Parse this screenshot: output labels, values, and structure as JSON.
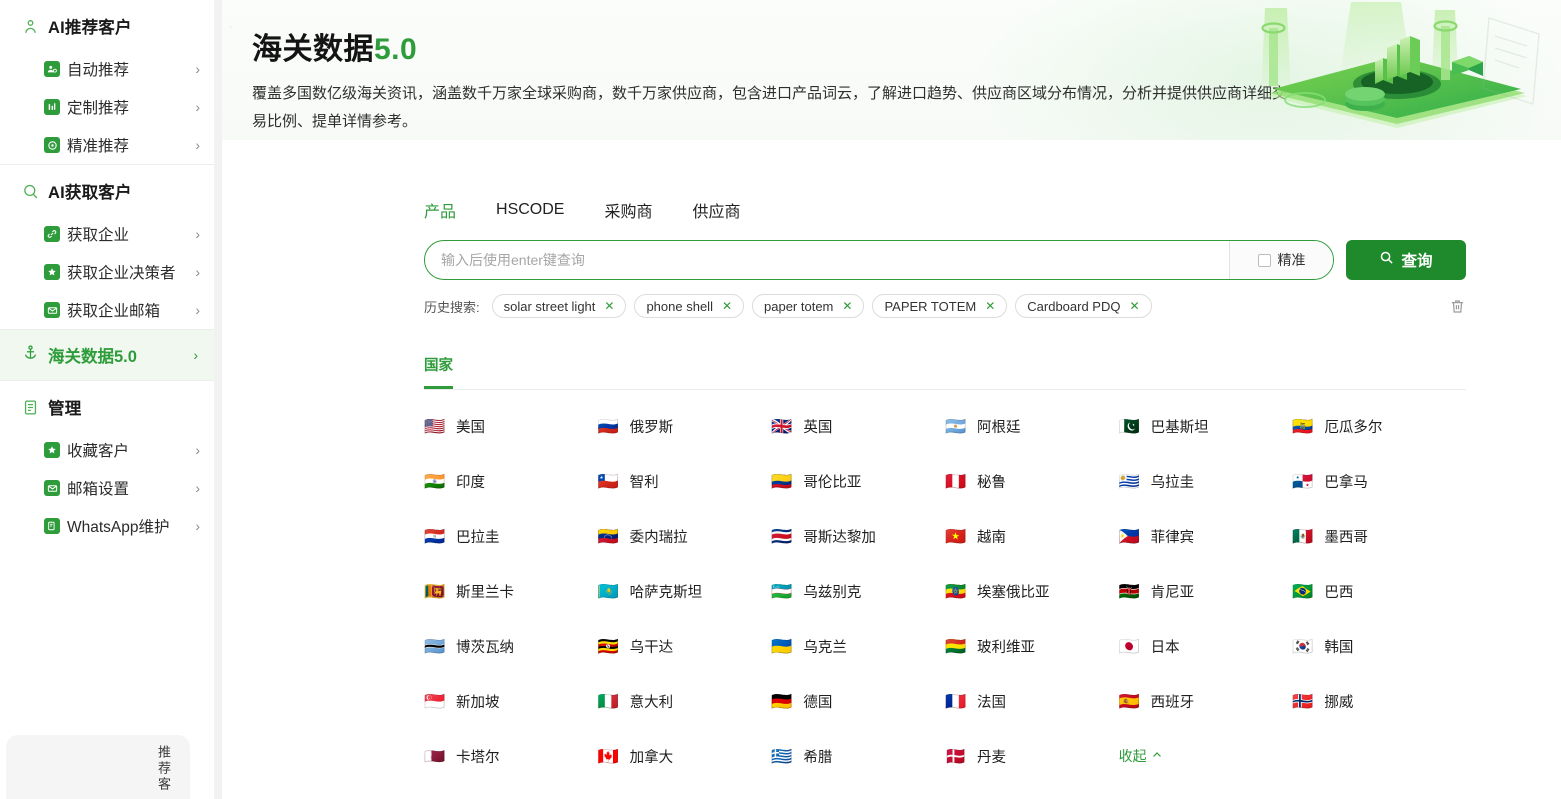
{
  "sidebar": {
    "groups": [
      {
        "title": "AI推荐客户",
        "icon": "person-icon",
        "items": [
          {
            "label": "自动推荐",
            "icon": "user-add-icon",
            "glyph": "☰"
          },
          {
            "label": "定制推荐",
            "icon": "sliders-icon",
            "glyph": "‖"
          },
          {
            "label": "精准推荐",
            "icon": "target-icon",
            "glyph": "◎"
          }
        ]
      },
      {
        "title": "AI获取客户",
        "icon": "search-circle-icon",
        "items": [
          {
            "label": "获取企业",
            "icon": "link-icon",
            "glyph": "✂"
          },
          {
            "label": "获取企业决策者",
            "icon": "star-badge-icon",
            "glyph": "✦"
          },
          {
            "label": "获取企业邮箱",
            "icon": "mail-icon",
            "glyph": "✉"
          }
        ]
      }
    ],
    "active_item": {
      "label": "海关数据5.0",
      "icon": "anchor-icon"
    },
    "manage_group": {
      "title": "管理",
      "icon": "list-doc-icon",
      "items": [
        {
          "label": "收藏客户",
          "icon": "star-badge-icon",
          "glyph": "✦"
        },
        {
          "label": "邮箱设置",
          "icon": "mail-icon",
          "glyph": "✉"
        },
        {
          "label": "WhatsApp维护",
          "icon": "note-edit-icon",
          "glyph": "✎"
        }
      ]
    },
    "float_card": {
      "text": "推荐客"
    }
  },
  "banner": {
    "title_main": "海关数据",
    "title_version": "5.0",
    "description": "覆盖多国数亿级海关资讯，涵盖数千万家全球采购商，数千万家供应商，包含进口产品词云，了解进口趋势、供应商区域分布情况，分析并提供供应商详细交易比例、提单详情参考。",
    "art": "isometric-green-data-platform-illustration"
  },
  "tabs": [
    {
      "label": "产品",
      "active": true
    },
    {
      "label": "HSCODE",
      "active": false
    },
    {
      "label": "采购商",
      "active": false
    },
    {
      "label": "供应商",
      "active": false
    }
  ],
  "search": {
    "placeholder": "输入后使用enter键查询",
    "value": "",
    "exact_label": "精准",
    "exact_checked": false,
    "query_button": "查询",
    "query_icon": "search-icon"
  },
  "history": {
    "label": "历史搜索:",
    "chips": [
      "solar street light",
      "phone shell",
      "paper totem",
      "PAPER TOTEM",
      "Cardboard PDQ"
    ],
    "clear_icon": "trash-icon"
  },
  "subtab": {
    "label": "国家"
  },
  "countries": [
    {
      "name": "美国",
      "flag": "🇺🇸"
    },
    {
      "name": "俄罗斯",
      "flag": "🇷🇺"
    },
    {
      "name": "英国",
      "flag": "🇬🇧"
    },
    {
      "name": "阿根廷",
      "flag": "🇦🇷"
    },
    {
      "name": "巴基斯坦",
      "flag": "🇵🇰"
    },
    {
      "name": "厄瓜多尔",
      "flag": "🇪🇨"
    },
    {
      "name": "印度",
      "flag": "🇮🇳"
    },
    {
      "name": "智利",
      "flag": "🇨🇱"
    },
    {
      "name": "哥伦比亚",
      "flag": "🇨🇴"
    },
    {
      "name": "秘鲁",
      "flag": "🇵🇪"
    },
    {
      "name": "乌拉圭",
      "flag": "🇺🇾"
    },
    {
      "name": "巴拿马",
      "flag": "🇵🇦"
    },
    {
      "name": "巴拉圭",
      "flag": "🇵🇾"
    },
    {
      "name": "委内瑞拉",
      "flag": "🇻🇪"
    },
    {
      "name": "哥斯达黎加",
      "flag": "🇨🇷"
    },
    {
      "name": "越南",
      "flag": "🇻🇳"
    },
    {
      "name": "菲律宾",
      "flag": "🇵🇭"
    },
    {
      "name": "墨西哥",
      "flag": "🇲🇽"
    },
    {
      "name": "斯里兰卡",
      "flag": "🇱🇰"
    },
    {
      "name": "哈萨克斯坦",
      "flag": "🇰🇿"
    },
    {
      "name": "乌兹别克",
      "flag": "🇺🇿"
    },
    {
      "name": "埃塞俄比亚",
      "flag": "🇪🇹"
    },
    {
      "name": "肯尼亚",
      "flag": "🇰🇪"
    },
    {
      "name": "巴西",
      "flag": "🇧🇷"
    },
    {
      "name": "博茨瓦纳",
      "flag": "🇧🇼"
    },
    {
      "name": "乌干达",
      "flag": "🇺🇬"
    },
    {
      "name": "乌克兰",
      "flag": "🇺🇦"
    },
    {
      "name": "玻利维亚",
      "flag": "🇧🇴"
    },
    {
      "name": "日本",
      "flag": "🇯🇵"
    },
    {
      "name": "韩国",
      "flag": "🇰🇷"
    },
    {
      "name": "新加坡",
      "flag": "🇸🇬"
    },
    {
      "name": "意大利",
      "flag": "🇮🇹"
    },
    {
      "name": "德国",
      "flag": "🇩🇪"
    },
    {
      "name": "法国",
      "flag": "🇫🇷"
    },
    {
      "name": "西班牙",
      "flag": "🇪🇸"
    },
    {
      "name": "挪威",
      "flag": "🇳🇴"
    },
    {
      "name": "卡塔尔",
      "flag": "🇶🇦"
    },
    {
      "name": "加拿大",
      "flag": "🇨🇦"
    },
    {
      "name": "希腊",
      "flag": "🇬🇷"
    },
    {
      "name": "丹麦",
      "flag": "🇩🇰"
    }
  ],
  "collapse": {
    "label": "收起",
    "icon": "chevron-up-icon"
  },
  "colors": {
    "brand_green": "#2e9c3a",
    "button_green": "#1f8a2c",
    "active_bg": "#f0f8f0",
    "text_dark": "#1a1a1a"
  }
}
